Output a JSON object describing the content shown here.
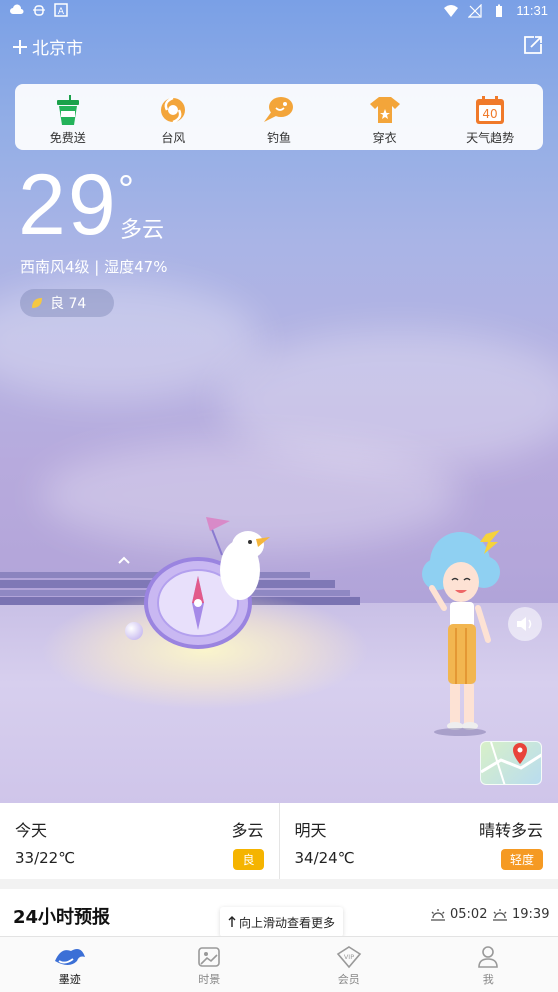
{
  "status_bar": {
    "time": "11:31"
  },
  "header": {
    "city": "北京市",
    "add_icon": "plus-icon",
    "share_icon": "share-icon"
  },
  "quick_actions": [
    {
      "label": "免费送",
      "icon": "drink-cup-icon"
    },
    {
      "label": "台风",
      "icon": "typhoon-icon"
    },
    {
      "label": "钓鱼",
      "icon": "fishing-icon"
    },
    {
      "label": "穿衣",
      "icon": "clothes-icon"
    },
    {
      "label": "天气趋势",
      "icon": "calendar-icon",
      "badge": "40"
    }
  ],
  "current": {
    "temperature": "29",
    "degree_symbol": "°",
    "condition": "多云",
    "wind_humidity": "西南风4级 | 湿度47%",
    "aqi": "良 74"
  },
  "forecast": [
    {
      "day": "今天",
      "condition": "多云",
      "temp": "33/22℃",
      "aqi": "良",
      "aqi_color": "#f5b400"
    },
    {
      "day": "明天",
      "condition": "晴转多云",
      "temp": "34/24℃",
      "aqi": "轻度",
      "aqi_color": "#f59a23"
    }
  ],
  "hourly": {
    "title": "24小时预报",
    "sunrise": "05:02",
    "sunset": "19:39",
    "swipe_tip": "向上滑动查看更多"
  },
  "tabs": [
    {
      "label": "墨迹",
      "icon": "moji-logo-icon",
      "active": true
    },
    {
      "label": "时景",
      "icon": "image-icon",
      "active": false
    },
    {
      "label": "会员",
      "icon": "vip-icon",
      "active": false
    },
    {
      "label": "我",
      "icon": "person-icon",
      "active": false
    }
  ],
  "colors": {
    "accent": "#f59a23",
    "sky_top": "#7aa0e6",
    "sky_bottom": "#a7a0d4"
  }
}
